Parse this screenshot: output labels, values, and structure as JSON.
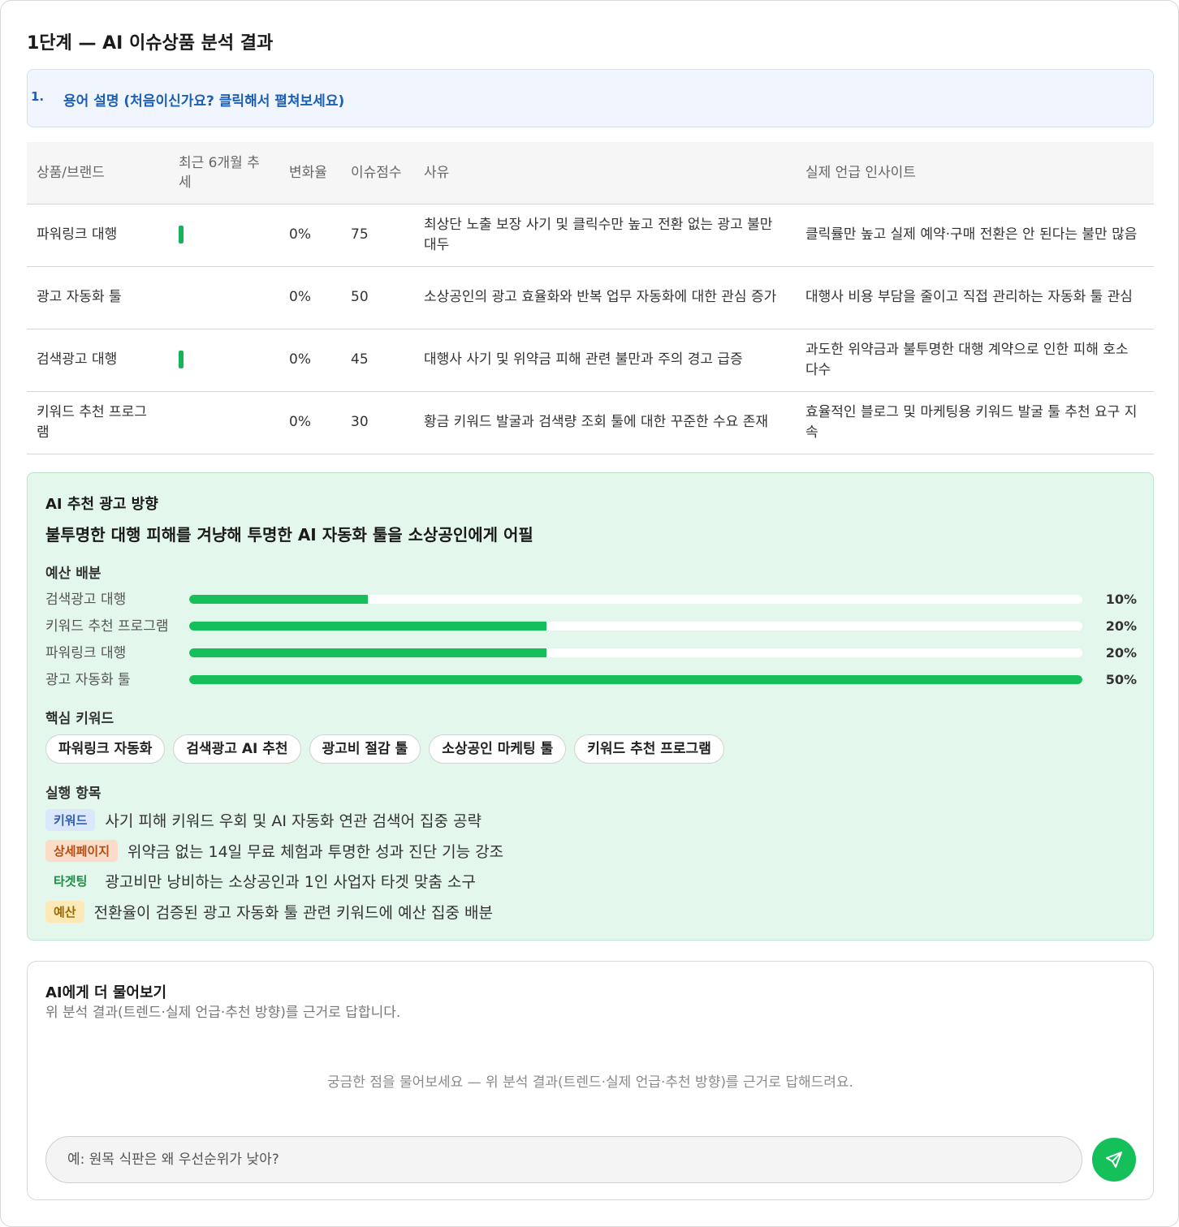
{
  "page": {
    "title": "1단계 — AI 이슈상품 분석 결과"
  },
  "glossary": {
    "number": "1.",
    "label": "용어 설명 (처음이신가요? 클릭해서 펼쳐보세요)"
  },
  "table": {
    "headers": {
      "product": "상품/브랜드",
      "trend": "최근 6개월 추세",
      "change": "변화율",
      "score": "이슈점수",
      "reason": "사유",
      "insight": "실제 언급 인사이트"
    },
    "rows": [
      {
        "product": "파워링크 대행",
        "has_trend": true,
        "change": "0%",
        "score": "75",
        "reason": "최상단 노출 보장 사기 및 클릭수만 높고 전환 없는 광고 불만 대두",
        "insight": "클릭률만 높고 실제 예약·구매 전환은 안 된다는 불만 많음"
      },
      {
        "product": "광고 자동화 툴",
        "has_trend": false,
        "change": "0%",
        "score": "50",
        "reason": "소상공인의 광고 효율화와 반복 업무 자동화에 대한 관심 증가",
        "insight": "대행사 비용 부담을 줄이고 직접 관리하는 자동화 툴 관심"
      },
      {
        "product": "검색광고 대행",
        "has_trend": true,
        "change": "0%",
        "score": "45",
        "reason": "대행사 사기 및 위약금 피해 관련 불만과 주의 경고 급증",
        "insight": "과도한 위약금과 불투명한 대행 계약으로 인한 피해 호소 다수"
      },
      {
        "product": "키워드 추천 프로그램",
        "has_trend": false,
        "change": "0%",
        "score": "30",
        "reason": "황금 키워드 발굴과 검색량 조회 툴에 대한 꾸준한 수요 존재",
        "insight": "효율적인 블로그 및 마케팅용 키워드 발굴 툴 추천 요구 지속"
      }
    ]
  },
  "recommendation": {
    "title": "AI 추천 광고 방향",
    "headline": "불투명한 대행 피해를 겨냥해 투명한 AI 자동화 툴을 소상공인에게 어필",
    "budget_title": "예산 배분",
    "budget": [
      {
        "label": "검색광고 대행",
        "percent": 10,
        "percent_label": "10%"
      },
      {
        "label": "키워드 추천 프로그램",
        "percent": 20,
        "percent_label": "20%"
      },
      {
        "label": "파워링크 대행",
        "percent": 20,
        "percent_label": "20%"
      },
      {
        "label": "광고 자동화 툴",
        "percent": 50,
        "percent_label": "50%"
      }
    ],
    "keywords_title": "핵심 키워드",
    "keywords": [
      "파워링크 자동화",
      "검색광고 AI 추천",
      "광고비 절감 툴",
      "소상공인 마케팅 툴",
      "키워드 추천 프로그램"
    ],
    "actions_title": "실행 항목",
    "actions": [
      {
        "tag": "키워드",
        "text": "사기 피해 키워드 우회 및 AI 자동화 연관 검색어 집중 공략"
      },
      {
        "tag": "상세페이지",
        "text": "위약금 없는 14일 무료 체험과 투명한 성과 진단 기능 강조"
      },
      {
        "tag": "타겟팅",
        "text": "광고비만 낭비하는 소상공인과 1인 사업자 타겟 맞춤 소구"
      },
      {
        "tag": "예산",
        "text": "전환율이 검증된 광고 자동화 툴 관련 키워드에 예산 집중 배분"
      }
    ],
    "colors": {
      "bar_fill": "#15c05a",
      "panel_bg": "#e3f7ec"
    }
  },
  "ask": {
    "title": "AI에게 더 물어보기",
    "subtitle": "위 분석 결과(트렌드·실제 언급·추천 방향)를 근거로 답합니다.",
    "empty_state": "궁금한 점을 물어보세요 — 위 분석 결과(트렌드·실제 언급·추천 방향)를 근거로 답해드려요.",
    "input_placeholder": "예: 원목 식판은 왜 우선순위가 낮아?",
    "send_icon": "send-icon"
  }
}
